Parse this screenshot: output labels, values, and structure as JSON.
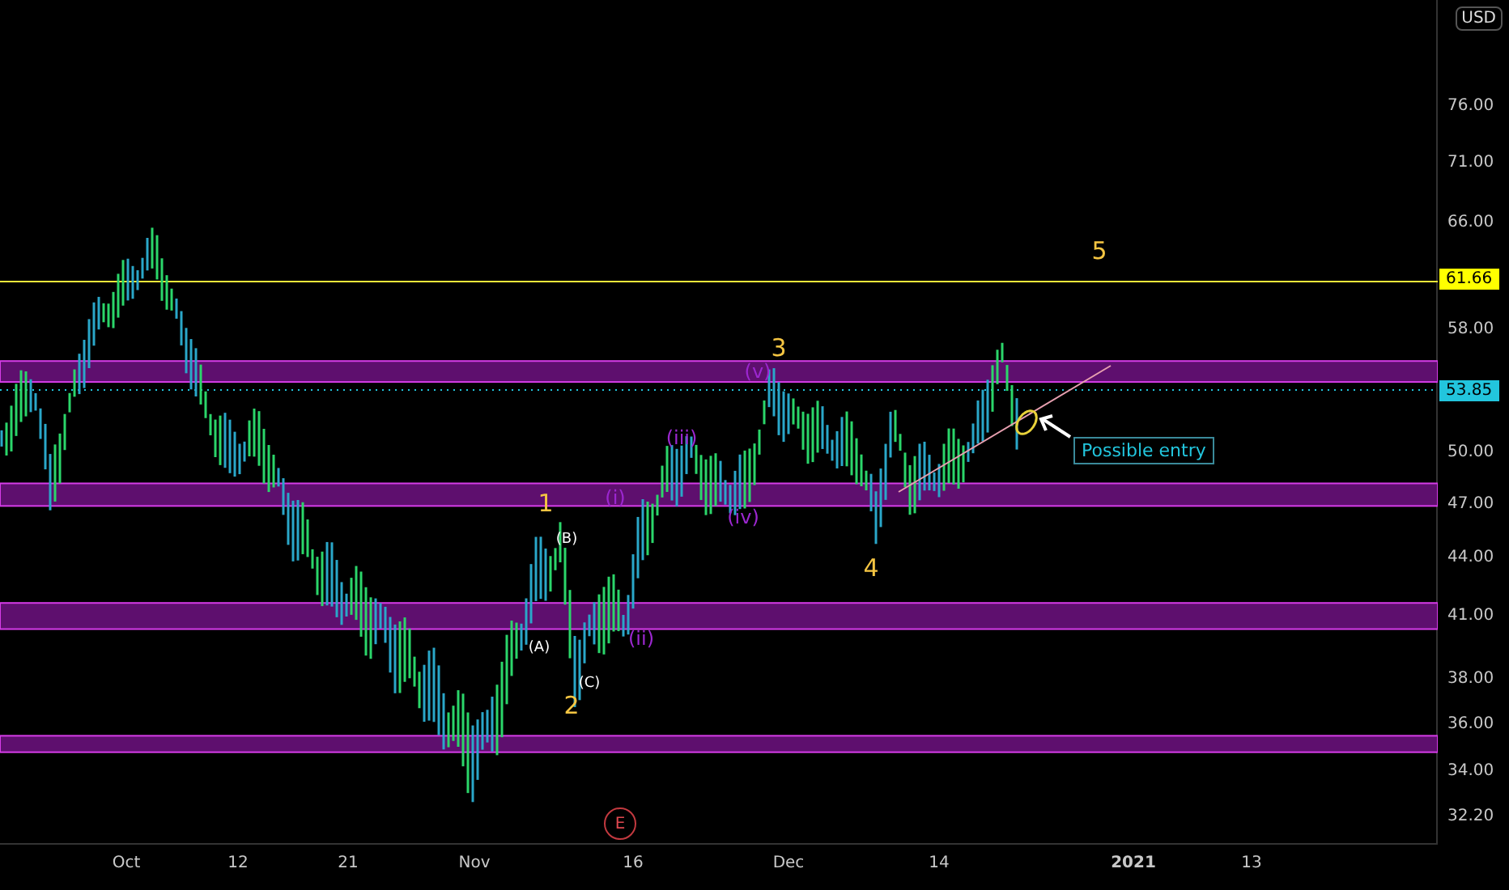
{
  "currency_button": "USD",
  "price_axis": {
    "ticks": [
      "76.00",
      "71.00",
      "66.00",
      "58.00",
      "50.00",
      "47.00",
      "44.00",
      "41.00",
      "38.00",
      "36.00",
      "34.00",
      "32.20"
    ],
    "price_labels": [
      {
        "text": "61.66",
        "color": "#ffff00"
      },
      {
        "text": "53.85",
        "color": "#22c5dd"
      }
    ]
  },
  "time_axis": [
    {
      "label": "Oct",
      "kind": "normal"
    },
    {
      "label": "12",
      "kind": "normal"
    },
    {
      "label": "21",
      "kind": "normal"
    },
    {
      "label": "Nov",
      "kind": "normal"
    },
    {
      "label": "16",
      "kind": "normal"
    },
    {
      "label": "Dec",
      "kind": "normal"
    },
    {
      "label": "14",
      "kind": "normal"
    },
    {
      "label": "2021",
      "kind": "year"
    },
    {
      "label": "13",
      "kind": "normal"
    }
  ],
  "wave_labels": [
    {
      "text": "5",
      "kind": "primary"
    },
    {
      "text": "3",
      "kind": "primary"
    },
    {
      "text": "1",
      "kind": "primary"
    },
    {
      "text": "2",
      "kind": "primary"
    },
    {
      "text": "4",
      "kind": "primary"
    },
    {
      "text": "(B)",
      "kind": "corrective"
    },
    {
      "text": "(A)",
      "kind": "corrective"
    },
    {
      "text": "(C)",
      "kind": "corrective"
    },
    {
      "text": "(i)",
      "kind": "minor"
    },
    {
      "text": "(ii)",
      "kind": "minor"
    },
    {
      "text": "(iii)",
      "kind": "minor"
    },
    {
      "text": "(iv)",
      "kind": "minor"
    },
    {
      "text": "(v)",
      "kind": "minor"
    }
  ],
  "callout": "Possible entry",
  "event_marker": "E"
}
